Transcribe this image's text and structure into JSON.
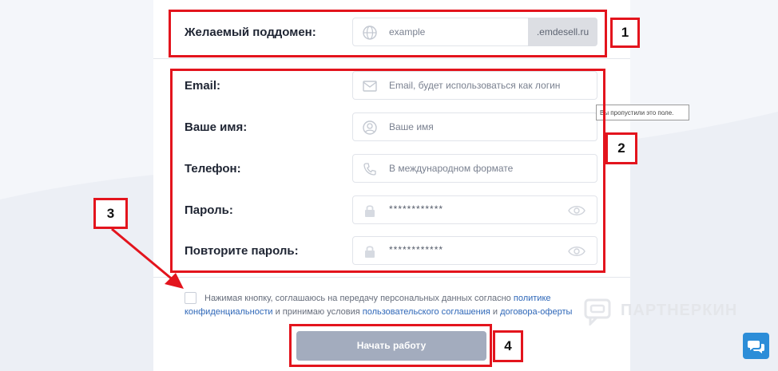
{
  "colors": {
    "annotation": "#e3141d",
    "link": "#2e67b8",
    "submit_bg": "#a3acbe",
    "chat_bg": "#2c8dd8"
  },
  "subdomain": {
    "label": "Желаемый поддомен:",
    "placeholder": "example",
    "suffix": ".emdesell.ru",
    "icon": "globe-icon"
  },
  "fields": [
    {
      "label": "Email:",
      "placeholder": "Email, будет использоваться как логин",
      "icon": "envelope-icon"
    },
    {
      "label": "Ваше имя:",
      "placeholder": "Ваше имя",
      "icon": "user-icon"
    },
    {
      "label": "Телефон:",
      "placeholder": "В международном формате",
      "icon": "phone-icon"
    },
    {
      "label": "Пароль:",
      "value": "************",
      "icon": "lock-icon"
    },
    {
      "label": "Повторите пароль:",
      "value": "************",
      "icon": "lock-icon"
    }
  ],
  "tooltip": "Вы пропустили это поле.",
  "consent": {
    "text1": "Нажимая кнопку, соглашаюсь на передачу персональных данных согласно ",
    "link1a": "политике",
    "link1b": "конфиденциальности",
    "text2": " и принимаю условия ",
    "link2": "пользовательского соглашения",
    "text3": " и ",
    "link3": "договора-оферты"
  },
  "submit_label": "Начать работу",
  "annotations": [
    "1",
    "2",
    "3",
    "4"
  ],
  "watermark": "ПАРТНЕРКИН"
}
